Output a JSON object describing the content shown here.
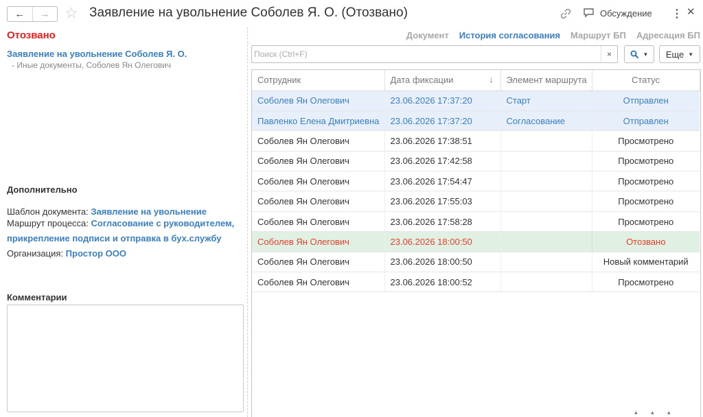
{
  "window": {
    "title": "Заявление на увольнение Соболев Я. О. (Отозвано)",
    "nav_back_icon": "arrow-left-icon",
    "nav_forward_icon": "arrow-right-icon",
    "favorite_icon": "star-icon",
    "link_icon": "link-icon",
    "discuss_label": "Обсуждение",
    "discuss_icon": "chat-icon",
    "more_icon": "kebab-menu-icon",
    "close_icon": "close-icon"
  },
  "left_panel": {
    "status": "Отозвано",
    "document_link": "Заявление на увольнение Соболев Я. О.",
    "document_sub": "- Иные документы, Соболев Ян Олегович",
    "additional_header": "Дополнительно",
    "template_label": "Шаблон документа:",
    "template_value": "Заявление на увольнение",
    "route_label": "Маршрут процесса:",
    "route_value_line1": "Согласование с руководителем,",
    "route_value_line2": "прикрепление подписи и отправка в бух.службу",
    "org_label": "Организация:",
    "org_value": "Простор ООО",
    "comments_header": "Комментарии",
    "comments_value": ""
  },
  "tabs": [
    {
      "label": "Документ",
      "active": false
    },
    {
      "label": "История согласования",
      "active": true
    },
    {
      "label": "Маршрут БП",
      "active": false
    },
    {
      "label": "Адресация БП",
      "active": false
    }
  ],
  "toolbar": {
    "search_placeholder": "Поиск (Ctrl+F)",
    "search_value": "",
    "clear_icon": "×",
    "search_icon": "magnifier-icon",
    "more_label": "Еще"
  },
  "table": {
    "columns": [
      "Сотрудник",
      "Дата фиксации",
      "Элемент маршрута",
      "Статус"
    ],
    "sort_indicator": "↓",
    "rows": [
      {
        "employee": "Соболев Ян Олегович",
        "date": "23.06.2026 17:37:20",
        "element": "Старт",
        "status": "Отправлен",
        "style": "hl"
      },
      {
        "employee": "Павленко Елена Дмитриевна",
        "date": "23.06.2026 17:37:20",
        "element": "Согласование",
        "status": "Отправлен",
        "style": "hl"
      },
      {
        "employee": "Соболев Ян Олегович",
        "date": "23.06.2026 17:38:51",
        "element": "",
        "status": "Просмотрено",
        "style": ""
      },
      {
        "employee": "Соболев Ян Олегович",
        "date": "23.06.2026 17:42:58",
        "element": "",
        "status": "Просмотрено",
        "style": ""
      },
      {
        "employee": "Соболев Ян Олегович",
        "date": "23.06.2026 17:54:47",
        "element": "",
        "status": "Просмотрено",
        "style": ""
      },
      {
        "employee": "Соболев Ян Олегович",
        "date": "23.06.2026 17:55:03",
        "element": "",
        "status": "Просмотрено",
        "style": ""
      },
      {
        "employee": "Соболев Ян Олегович",
        "date": "23.06.2026 17:58:28",
        "element": "",
        "status": "Просмотрено",
        "style": ""
      },
      {
        "employee": "Соболев Ян Олегович",
        "date": "23.06.2026 18:00:50",
        "element": "",
        "status": "Отозвано",
        "style": "red"
      },
      {
        "employee": "Соболев Ян Олегович",
        "date": "23.06.2026 18:00:50",
        "element": "",
        "status": "Новый комментарий",
        "style": ""
      },
      {
        "employee": "Соболев Ян Олегович",
        "date": "23.06.2026 18:00:52",
        "element": "",
        "status": "Просмотрено",
        "style": ""
      }
    ]
  },
  "colors": {
    "accent_blue": "#3a7fc1",
    "status_red": "#e81b1b",
    "row_highlight": "#e7f0fa",
    "row_recalled": "#e0f0e2"
  }
}
